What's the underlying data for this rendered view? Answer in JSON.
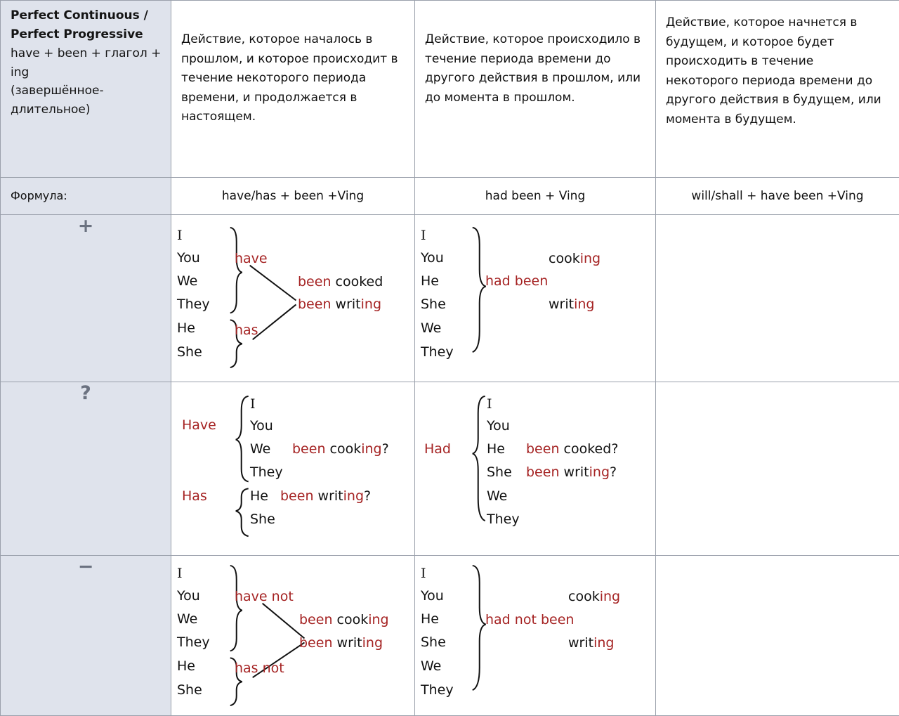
{
  "tense": {
    "title": "Perfect Continuous / Perfect Progressive",
    "formula_line": "have + been + глагол + ing",
    "russian_name": "(завершённое-длительное)"
  },
  "columns": {
    "present_desc": "Действие, которое началось в прошлом, и которое происходит в течение некоторого периода времени, и продолжается в настоящем.",
    "past_desc": "Действие, которое происходило в течение периода времени до другого действия в прошлом, или до момента в прошлом.",
    "future_desc": "Действие, которое начнется в будущем, и которое будет происходить в течение некоторого периода времени до другого действия в будущем, или момента в будущем."
  },
  "formula_row": {
    "label": "Формула:",
    "present": "have/has + been +Ving",
    "past": "had been + Ving",
    "future": "will/shall + have been +Ving"
  },
  "signs": {
    "affirmative": "+",
    "question": "?",
    "negative": "−"
  },
  "affirmative": {
    "present": {
      "group_a": [
        "I",
        "You",
        "We",
        "They"
      ],
      "group_b": [
        "He",
        "She"
      ],
      "aux_a": "have",
      "aux_b": "has",
      "result_1_red": "been",
      "result_1_blk": "cooked",
      "result_2_red": "been",
      "result_2_blk": "writ",
      "result_2_red2": "ing"
    },
    "past": {
      "pronouns": [
        "I",
        "You",
        "He",
        "She",
        "We",
        "They"
      ],
      "aux": "had been",
      "verb_1_blk": "cook",
      "verb_1_red": "ing",
      "verb_2_blk": "writ",
      "verb_2_red": "ing"
    },
    "future": ""
  },
  "question": {
    "present": {
      "aux_a": "Have",
      "aux_b": "Has",
      "group_a": [
        "I",
        "You",
        "We",
        "They"
      ],
      "group_b": [
        "He",
        "She"
      ],
      "phrase_1_red": "been",
      "phrase_1_blk": "cook",
      "phrase_1_red2": "ing",
      "phrase_1_mark": "?",
      "phrase_2_red": "been",
      "phrase_2_blk": "writ",
      "phrase_2_red2": "ing",
      "phrase_2_mark": "?"
    },
    "past": {
      "aux": "Had",
      "pronouns": [
        "I",
        "You",
        "He",
        "She",
        "We",
        "They"
      ],
      "phrase_1_red": "been",
      "phrase_1_blk": "cooked",
      "phrase_1_mark": "?",
      "phrase_2_red": "been",
      "phrase_2_blk": "writ",
      "phrase_2_red2": "ing",
      "phrase_2_mark": "?"
    },
    "future": ""
  },
  "negative": {
    "present": {
      "group_a": [
        "I",
        "You",
        "We",
        "They"
      ],
      "group_b": [
        "He",
        "She"
      ],
      "aux_a": "have not",
      "aux_b": "has not",
      "result_1_red": "been",
      "result_1_blk": "cook",
      "result_1_red2": "ing",
      "result_2_red": "been",
      "result_2_blk": "writ",
      "result_2_red2": "ing"
    },
    "past": {
      "pronouns": [
        "I",
        "You",
        "He",
        "She",
        "We",
        "They"
      ],
      "aux": "had not been",
      "verb_1_blk": "cook",
      "verb_1_red": "ing",
      "verb_2_blk": "writ",
      "verb_2_red": "ing"
    },
    "future": ""
  },
  "colors": {
    "accent_red": "#a52323",
    "text": "#111111",
    "shade_bg": "#dfe3ec",
    "border": "#9aa0ab",
    "sign_gray": "#6b7280"
  }
}
